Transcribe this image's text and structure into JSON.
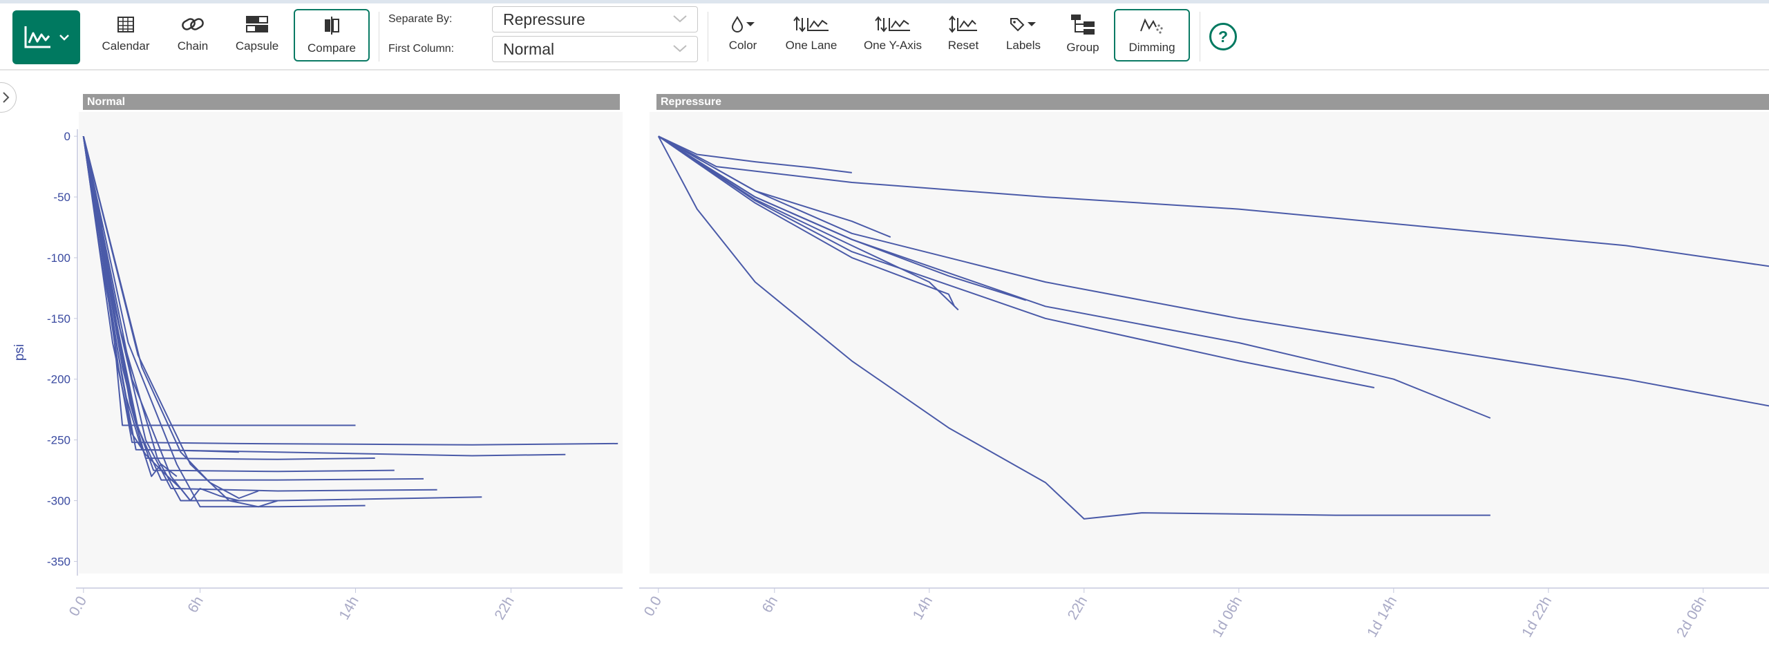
{
  "toolbar": {
    "chart_type_icon": "line-chart-icon",
    "buttons": {
      "calendar": {
        "label": "Calendar",
        "icon": "calendar-icon"
      },
      "chain": {
        "label": "Chain",
        "icon": "chain-link-icon"
      },
      "capsule": {
        "label": "Capsule",
        "icon": "capsule-icon"
      },
      "compare": {
        "label": "Compare",
        "icon": "compare-icon",
        "active": true
      },
      "color": {
        "label": "Color",
        "icon": "color-drop-icon"
      },
      "one_lane": {
        "label": "One Lane",
        "icon": "one-lane-icon"
      },
      "one_y_axis": {
        "label": "One Y-Axis",
        "icon": "one-y-axis-icon"
      },
      "reset": {
        "label": "Reset",
        "icon": "reset-axis-icon"
      },
      "labels": {
        "label": "Labels",
        "icon": "tag-icon"
      },
      "group": {
        "label": "Group",
        "icon": "group-icon"
      },
      "dimming": {
        "label": "Dimming",
        "icon": "dimming-icon",
        "active": true
      }
    },
    "separate_by": {
      "label": "Separate By:",
      "value": "Repressure"
    },
    "first_column": {
      "label": "First Column:",
      "value": "Normal"
    },
    "help_label": "?"
  },
  "colors": {
    "accent": "#007960",
    "series": "#4a5aa8",
    "axis_text": "#3a4aa0",
    "header": "#999999"
  },
  "chart_data": [
    {
      "type": "line",
      "title": "Normal",
      "ylabel": "psi",
      "yticks": [
        0,
        -50,
        -100,
        -150,
        -200,
        -250,
        -300,
        -350
      ],
      "ylim": [
        -360,
        20
      ],
      "xticks": [
        {
          "label": "0.0",
          "h": 0
        },
        {
          "label": "6h",
          "h": 6
        },
        {
          "label": "14h",
          "h": 14
        },
        {
          "label": "22h",
          "h": 22
        }
      ],
      "xlim_hours": [
        -0.1,
        27.6
      ],
      "series": [
        {
          "points": [
            [
              0,
              0
            ],
            [
              0.4,
              -45
            ],
            [
              1.0,
              -75
            ]
          ]
        },
        {
          "points": [
            [
              0,
              0
            ],
            [
              0.8,
              -80
            ],
            [
              1.6,
              -170
            ],
            [
              2.0,
              -238
            ],
            [
              4,
              -238
            ],
            [
              14,
              -238
            ]
          ]
        },
        {
          "points": [
            [
              0,
              0
            ],
            [
              0.9,
              -90
            ],
            [
              1.8,
              -190
            ],
            [
              2.5,
              -252
            ],
            [
              8,
              -253
            ],
            [
              20,
              -254
            ],
            [
              27.5,
              -253
            ]
          ]
        },
        {
          "points": [
            [
              0,
              0
            ],
            [
              1.0,
              -100
            ],
            [
              2.0,
              -200
            ],
            [
              2.7,
              -258
            ],
            [
              10,
              -260
            ],
            [
              20,
              -263
            ],
            [
              24.8,
              -262
            ]
          ]
        },
        {
          "points": [
            [
              0,
              0
            ],
            [
              1.2,
              -110
            ],
            [
              2.4,
              -220
            ],
            [
              3.2,
              -265
            ],
            [
              10,
              -266
            ],
            [
              15,
              -265
            ]
          ]
        },
        {
          "points": [
            [
              0,
              0
            ],
            [
              1.0,
              -110
            ],
            [
              2.2,
              -215
            ],
            [
              3.0,
              -258
            ],
            [
              6,
              -259
            ],
            [
              8,
              -260
            ]
          ]
        },
        {
          "points": [
            [
              0,
              0
            ],
            [
              1.3,
              -120
            ],
            [
              2.6,
              -230
            ],
            [
              3.6,
              -275
            ],
            [
              10,
              -276
            ],
            [
              16,
              -275
            ]
          ]
        },
        {
          "points": [
            [
              0,
              0
            ],
            [
              1.4,
              -130
            ],
            [
              2.8,
              -240
            ],
            [
              4.0,
              -283
            ],
            [
              10,
              -283
            ],
            [
              17.5,
              -282
            ]
          ]
        },
        {
          "points": [
            [
              0,
              0
            ],
            [
              1.6,
              -140
            ],
            [
              3.2,
              -250
            ],
            [
              4.5,
              -290
            ],
            [
              10,
              -292
            ],
            [
              18.2,
              -291
            ]
          ]
        },
        {
          "points": [
            [
              0,
              0
            ],
            [
              1.9,
              -160
            ],
            [
              3.8,
              -265
            ],
            [
              5.0,
              -300
            ],
            [
              10,
              -300
            ],
            [
              20.5,
              -297
            ]
          ]
        },
        {
          "points": [
            [
              0,
              0
            ],
            [
              2.3,
              -170
            ],
            [
              4.8,
              -270
            ],
            [
              6.0,
              -305
            ],
            [
              10,
              -305
            ],
            [
              14.5,
              -304
            ]
          ]
        },
        {
          "points": [
            [
              0,
              0
            ],
            [
              2.8,
              -180
            ],
            [
              5.5,
              -270
            ],
            [
              7.5,
              -300
            ],
            [
              9,
              -305
            ],
            [
              10,
              -300
            ]
          ]
        },
        {
          "points": [
            [
              0,
              0
            ],
            [
              2.0,
              -190
            ],
            [
              3.0,
              -255
            ],
            [
              3.5,
              -280
            ],
            [
              4.0,
              -270
            ],
            [
              4.8,
              -280
            ]
          ]
        },
        {
          "points": [
            [
              0,
              0
            ],
            [
              1.5,
              -170
            ],
            [
              2.5,
              -245
            ],
            [
              3.2,
              -262
            ],
            [
              4,
              -275
            ],
            [
              5,
              -290
            ],
            [
              5.5,
              -300
            ]
          ]
        },
        {
          "points": [
            [
              0,
              0
            ],
            [
              2.5,
              -200
            ],
            [
              4.5,
              -280
            ],
            [
              5.5,
              -300
            ],
            [
              6,
              -290
            ],
            [
              7,
              -296
            ],
            [
              8,
              -300
            ]
          ]
        },
        {
          "points": [
            [
              0,
              0
            ],
            [
              3.0,
              -190
            ],
            [
              5.0,
              -260
            ],
            [
              6.5,
              -285
            ],
            [
              8.0,
              -298
            ],
            [
              9.0,
              -292
            ]
          ]
        }
      ]
    },
    {
      "type": "line",
      "title": "Repressure",
      "xticks": [
        {
          "label": "0.0",
          "h": 0
        },
        {
          "label": "6h",
          "h": 6
        },
        {
          "label": "14h",
          "h": 14
        },
        {
          "label": "22h",
          "h": 22
        },
        {
          "label": "1d 06h",
          "h": 30
        },
        {
          "label": "1d 14h",
          "h": 38
        },
        {
          "label": "1d 22h",
          "h": 46
        },
        {
          "label": "2d 06h",
          "h": 54
        }
      ],
      "xlim_hours": [
        -0.1,
        57.4
      ],
      "series": [
        {
          "points": [
            [
              0,
              0
            ],
            [
              2,
              -15
            ],
            [
              5,
              -21
            ],
            [
              8,
              -26
            ],
            [
              10,
              -30
            ]
          ]
        },
        {
          "points": [
            [
              0,
              0
            ],
            [
              3,
              -25
            ],
            [
              10,
              -38
            ],
            [
              20,
              -50
            ],
            [
              30,
              -60
            ],
            [
              40,
              -75
            ],
            [
              50,
              -90
            ],
            [
              57.4,
              -107
            ]
          ]
        },
        {
          "points": [
            [
              0,
              0
            ],
            [
              5,
              -45
            ],
            [
              10,
              -70
            ],
            [
              12,
              -83
            ]
          ]
        },
        {
          "points": [
            [
              0,
              0
            ],
            [
              5,
              -50
            ],
            [
              10,
              -85
            ],
            [
              15,
              -115
            ],
            [
              19,
              -135
            ]
          ]
        },
        {
          "points": [
            [
              0,
              0
            ],
            [
              5,
              -55
            ],
            [
              10,
              -100
            ],
            [
              15,
              -130
            ],
            [
              15.3,
              -140
            ]
          ]
        },
        {
          "points": [
            [
              0,
              0
            ],
            [
              5,
              -52
            ],
            [
              10,
              -90
            ],
            [
              14,
              -120
            ],
            [
              15.5,
              -143
            ]
          ]
        },
        {
          "points": [
            [
              0,
              0
            ],
            [
              5,
              -50
            ],
            [
              10,
              -85
            ],
            [
              20,
              -140
            ],
            [
              30,
              -170
            ],
            [
              38,
              -200
            ],
            [
              43,
              -232
            ]
          ]
        },
        {
          "points": [
            [
              0,
              0
            ],
            [
              5,
              -53
            ],
            [
              10,
              -95
            ],
            [
              20,
              -150
            ],
            [
              30,
              -185
            ],
            [
              37,
              -207
            ]
          ]
        },
        {
          "points": [
            [
              0,
              0
            ],
            [
              5,
              -45
            ],
            [
              10,
              -80
            ],
            [
              20,
              -120
            ],
            [
              30,
              -150
            ],
            [
              40,
              -175
            ],
            [
              50,
              -200
            ],
            [
              57.4,
              -222
            ]
          ]
        },
        {
          "points": [
            [
              0,
              0
            ],
            [
              2,
              -60
            ],
            [
              5,
              -120
            ],
            [
              10,
              -185
            ],
            [
              15,
              -240
            ],
            [
              20,
              -285
            ],
            [
              22,
              -315
            ],
            [
              25,
              -310
            ],
            [
              35,
              -312
            ],
            [
              43,
              -312
            ]
          ]
        }
      ]
    }
  ]
}
